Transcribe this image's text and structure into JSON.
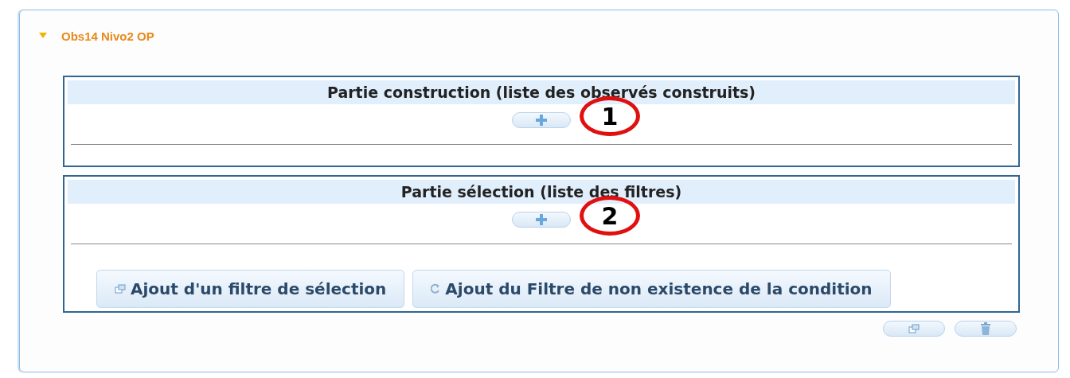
{
  "panel": {
    "title": "Obs14 Nivo2 OP",
    "expanded": true
  },
  "sections": [
    {
      "title": "Partie construction (liste des observés construits)",
      "annotation": "1"
    },
    {
      "title": "Partie sélection (liste des filtres)",
      "annotation": "2",
      "buttons": [
        {
          "kind": "copy",
          "label": "Ajout d'un filtre de sélection"
        },
        {
          "kind": "refresh",
          "label": "Ajout du Filtre de non existence de la condition"
        }
      ]
    }
  ],
  "footer_buttons": [
    {
      "kind": "copy"
    },
    {
      "kind": "trash"
    }
  ]
}
